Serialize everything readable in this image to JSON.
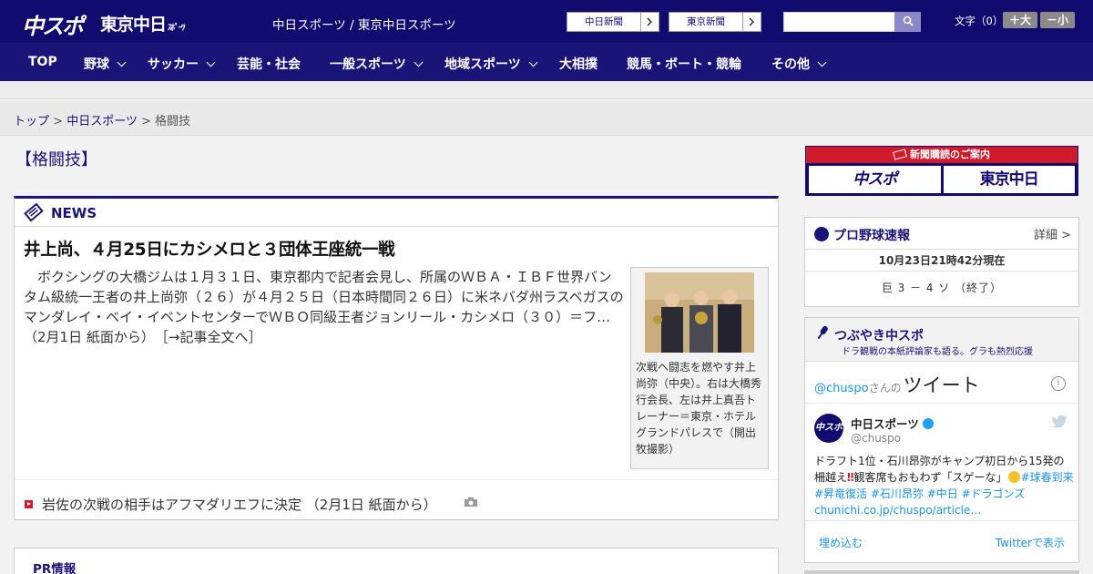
{
  "header": {
    "logo_chuspo": "中スポ",
    "logo_tokyo": "東京中日",
    "logo_tokyo_small": "ｽﾎﾟｰﾂ",
    "site_names": "中日スポーツ / 東京中日スポーツ",
    "newspaper_buttons": [
      "中日新聞",
      "東京新聞"
    ],
    "search_placeholder": "",
    "font_size_label": "文字（0）",
    "font_larger": "＋大",
    "font_smaller": "－小"
  },
  "nav": {
    "items": [
      {
        "label": "TOP",
        "has_menu": false
      },
      {
        "label": "野球",
        "has_menu": true
      },
      {
        "label": "サッカー",
        "has_menu": true
      },
      {
        "label": "芸能・社会",
        "has_menu": false
      },
      {
        "label": "一般スポーツ",
        "has_menu": true
      },
      {
        "label": "地域スポーツ",
        "has_menu": true
      },
      {
        "label": "大相撲",
        "has_menu": false
      },
      {
        "label": "競馬・ボート・競輪",
        "has_menu": false
      },
      {
        "label": "その他",
        "has_menu": true
      }
    ]
  },
  "breadcrumb": {
    "items": [
      "トップ",
      "中日スポーツ",
      "格闘技"
    ],
    "separator": ">"
  },
  "page_title": "【格闘技】",
  "news": {
    "section_label": "NEWS",
    "article": {
      "title": "井上尚、４月25日にカシメロと３団体王座統一戦",
      "body": "　ボクシングの大橋ジムは１月３１日、東京都内で記者会見し、所属のＷＢＡ・ＩＢＦ世界バンタム級統一王者の井上尚弥（２６）が４月２５日（日本時間同２６日）に米ネバダ州ラスベガスのマンダレイ・ベイ・イベントセンターでＷＢＯ同級王者ジョンリール・カシメロ（３０）＝フ…",
      "source": "（2月1日 紙面から）",
      "read_more": "［→記事全文へ］",
      "photo_caption": "次戦へ闘志を燃やす井上尚弥（中央）。右は大橋秀行会長、左は井上真吾トレーナー＝東京・ホテルグランドパレスで（開出牧撮影）"
    },
    "related": [
      {
        "text": "岩佐の次戦の相手はアフマダリエフに決定 （2月1日 紙面から）",
        "has_photo": true
      }
    ]
  },
  "pr": {
    "label": "PR情報"
  },
  "sidebar": {
    "subscribe": {
      "heading": "新聞購読のご案内",
      "logos": [
        "中スポ",
        "東京中日"
      ]
    },
    "baseball": {
      "title": "プロ野球速報",
      "detail_link": "詳細 >",
      "timestamp": "10月23日21時42分現在",
      "score_line": "巨 3 － 4 ソ （終了）"
    },
    "tweets": {
      "title": "つぶやき中スポ",
      "subtitle": "ドラ観戦の本紙評論家も語る。グラも熱烈応援",
      "account_link": "@chuspo",
      "san": "さんの",
      "tweet_word": "ツイート",
      "user_name": "中日スポーツ",
      "user_handle": "@chuspo",
      "tweet_text_1": "ドラフト1位・石川昂弥がキャンプ初日から15発の柵越え",
      "tweet_text_2": "観客席もおもわず「スゲーな」",
      "tweet_tags": "#球春到来 #昇竜復活 #石川昂弥 #中日 #ドラゴンズ",
      "tweet_link": "chunichi.co.jp/chuspo/article…",
      "embed": "埋め込む",
      "view_on_twitter": "Twitterで表示"
    }
  },
  "colors": {
    "header_bg": "#110a6f",
    "nav_bg": "#1a1478",
    "accent_red": "#d21b2a",
    "link_blue": "#1b95e0"
  }
}
